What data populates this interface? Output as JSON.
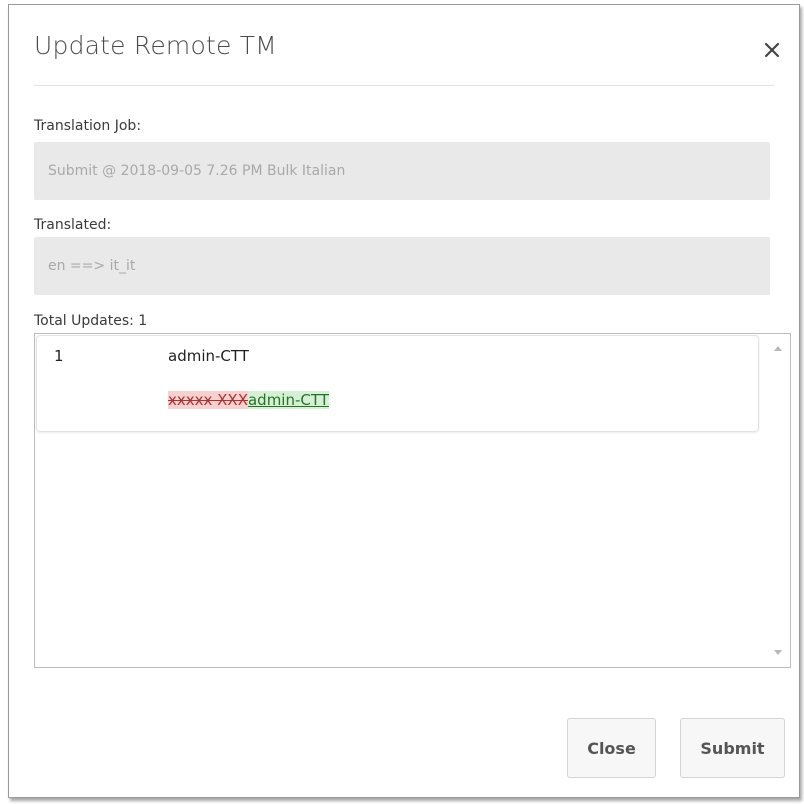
{
  "dialog": {
    "title": "Update Remote TM",
    "close_icon": "close-icon"
  },
  "translation_job": {
    "label": "Translation Job:",
    "value": "Submit @ 2018-09-05 7.26 PM Bulk Italian"
  },
  "translated": {
    "label": "Translated:",
    "value": "en ==> it_it"
  },
  "updates": {
    "label": "Total Updates: 1",
    "rows": [
      {
        "number": "1",
        "name": "admin-CTT",
        "removed": "xxxxx XXX",
        "added": "admin-CTT"
      }
    ]
  },
  "buttons": {
    "close": "Close",
    "submit": "Submit"
  },
  "colors": {
    "diff_removed_bg": "#f7d0d0",
    "diff_added_bg": "#d6f0d6"
  }
}
